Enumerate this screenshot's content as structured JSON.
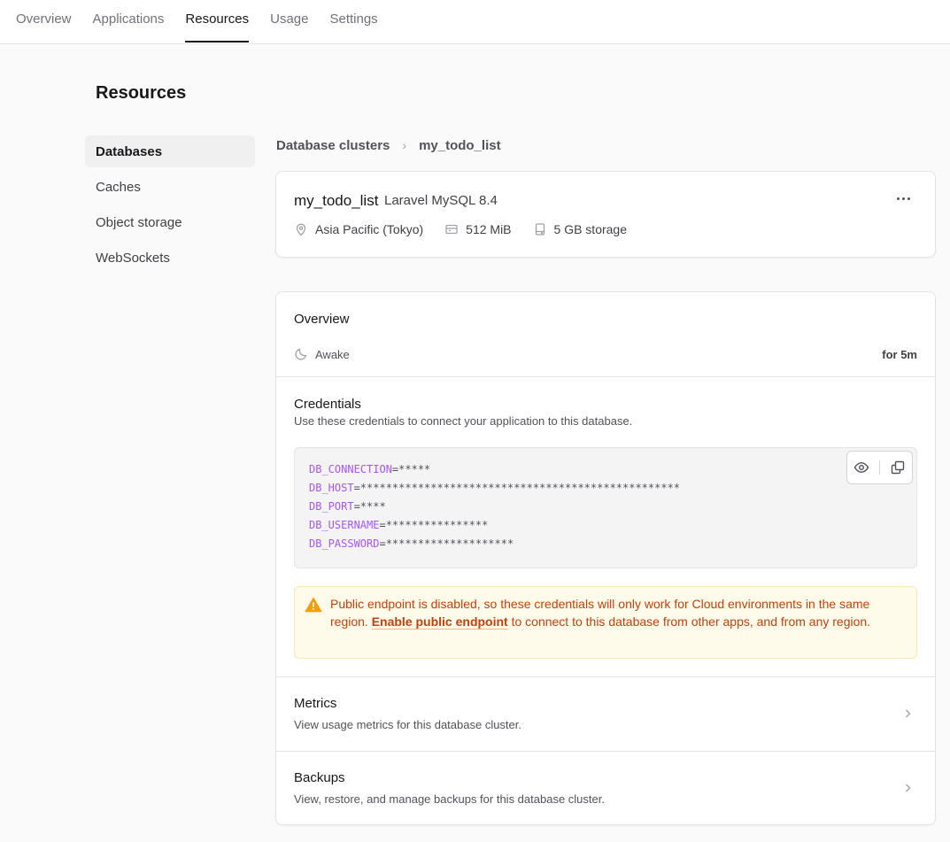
{
  "topnav": {
    "tabs": [
      {
        "label": "Overview"
      },
      {
        "label": "Applications"
      },
      {
        "label": "Resources"
      },
      {
        "label": "Usage"
      },
      {
        "label": "Settings"
      }
    ],
    "active": "Resources"
  },
  "page": {
    "title": "Resources"
  },
  "sidebar": {
    "items": [
      {
        "label": "Databases"
      },
      {
        "label": "Caches"
      },
      {
        "label": "Object storage"
      },
      {
        "label": "WebSockets"
      }
    ],
    "active": "Databases"
  },
  "breadcrumb": {
    "parent": "Database clusters",
    "separator": "›",
    "current": "my_todo_list"
  },
  "cluster": {
    "name": "my_todo_list",
    "engine": "Laravel MySQL 8.4",
    "region": "Asia Pacific (Tokyo)",
    "memory": "512 MiB",
    "storage": "5 GB storage"
  },
  "overview": {
    "title": "Overview",
    "status": "Awake",
    "duration": "for 5m"
  },
  "credentials": {
    "title": "Credentials",
    "description": "Use these credentials to connect your application to this database.",
    "lines": [
      {
        "key": "DB_CONNECTION",
        "value": "=*****"
      },
      {
        "key": "DB_HOST",
        "value": "=**************************************************"
      },
      {
        "key": "DB_PORT",
        "value": "=****"
      },
      {
        "key": "DB_USERNAME",
        "value": "=****************"
      },
      {
        "key": "DB_PASSWORD",
        "value": "=********************"
      }
    ]
  },
  "alert": {
    "text_before": "Public endpoint is disabled, so these credentials will only work for Cloud environments in the same region. ",
    "link": "Enable public endpoint",
    "text_after": " to connect to this database from other apps, and from any region."
  },
  "metrics": {
    "title": "Metrics",
    "description": "View usage metrics for this database cluster."
  },
  "backups": {
    "title": "Backups",
    "description": "View, restore, and manage backups for this database cluster."
  },
  "colors": {
    "accent_code_key": "#a855f7",
    "alert_text": "#c2410c",
    "alert_bg": "#fefbeb",
    "warning_icon": "#f59e0b"
  },
  "icons": {
    "region": "map-pin-icon",
    "memory": "memory-icon",
    "storage": "storage-icon",
    "status": "moon-icon",
    "reveal": "eye-icon",
    "copy": "copy-icon",
    "warning": "warning-icon",
    "more": "more-dots-icon",
    "nav": "chevron-right-icon"
  }
}
